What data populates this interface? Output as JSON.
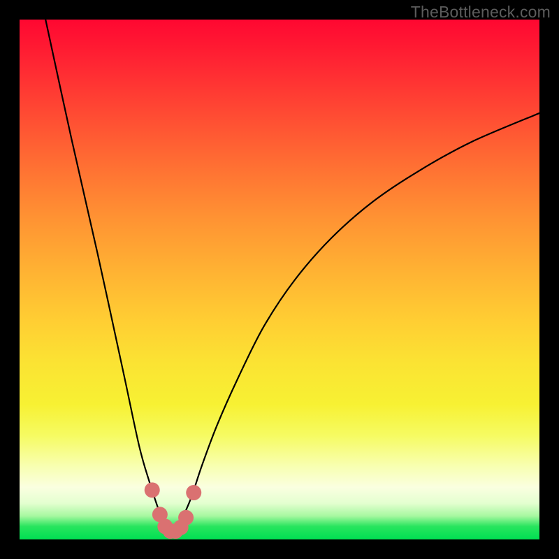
{
  "watermark": "TheBottleneck.com",
  "colors": {
    "frame": "#000000",
    "curve": "#000000",
    "marker": "#da7171",
    "gradient_top": "#ff0731",
    "gradient_bottom": "#00df52"
  },
  "chart_data": {
    "type": "line",
    "title": "",
    "xlabel": "",
    "ylabel": "",
    "xlim": [
      0,
      100
    ],
    "ylim": [
      0,
      100
    ],
    "note": "Bottleneck-style V curve. y ≈ percentage mismatch; minimum near x≈29. Values estimated from pixels (no axis ticks in image).",
    "series": [
      {
        "name": "bottleneck-curve",
        "x": [
          5,
          10,
          15,
          20,
          23,
          25,
          27,
          28,
          29,
          30,
          31,
          33,
          35,
          38,
          42,
          47,
          53,
          60,
          68,
          77,
          87,
          100
        ],
        "values": [
          100,
          77,
          55,
          32,
          18,
          11,
          5,
          2.5,
          1.5,
          2,
          3.5,
          8,
          14,
          22,
          31,
          41,
          50,
          58,
          65,
          71,
          76.5,
          82
        ]
      }
    ],
    "markers": {
      "name": "highlight-dots",
      "color": "#da7171",
      "x": [
        25.5,
        27,
        28,
        29,
        30,
        31,
        32,
        33.5
      ],
      "values": [
        9.5,
        4.8,
        2.5,
        1.6,
        1.6,
        2.3,
        4.2,
        9.0
      ]
    }
  }
}
